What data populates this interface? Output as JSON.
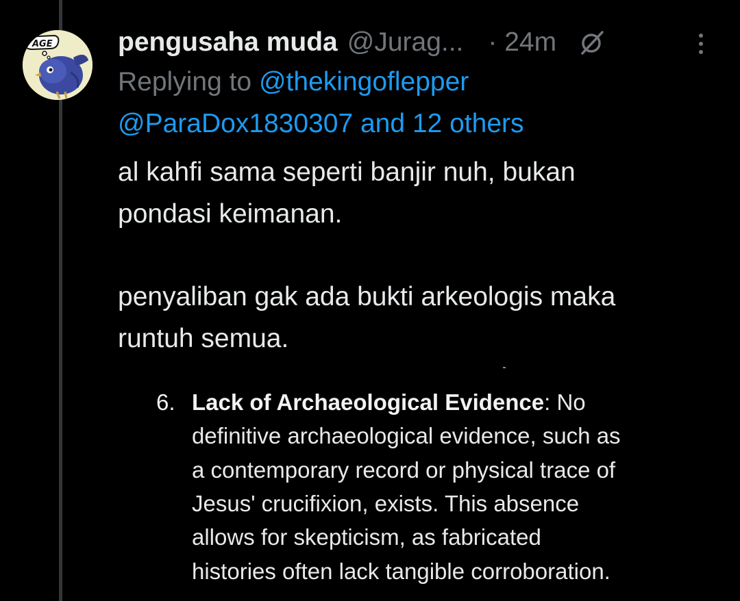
{
  "tweet": {
    "display_name": "pengusaha muda",
    "handle": "@Jurag...",
    "time": "· 24m",
    "grok_icon": "slash-circle-icon",
    "more_icon": "more-vertical-icon",
    "avatar_icon": "bird-cartoon-avatar",
    "avatar_bubble_text": "AGE",
    "replying_prefix": "Replying to",
    "replying_mention_1": "@thekingoflepper",
    "replying_mention_2_line": "@ParaDox1830307 and 12 others",
    "body_lines": [
      "al kahfi sama seperti banjir nuh, bukan",
      "pondasi keimanan.",
      "penyaliban gak ada bukti arkeologis maka",
      "runtuh semua."
    ]
  },
  "excerpt": {
    "number": "6.",
    "heading": "Lack of Archaeological Evidence",
    "first_line_rest": ": No",
    "lines": [
      "definitive archaeological evidence, such as",
      "a contemporary record or physical trace of",
      "Jesus' crucifixion, exists. This absence",
      "allows for skepticism, as fabricated",
      "histories often lack tangible corroboration."
    ]
  },
  "colors": {
    "background": "#000000",
    "text": "#e7e9ea",
    "muted": "#71767b",
    "link": "#1d9bf0",
    "thread_line": "#333639"
  }
}
